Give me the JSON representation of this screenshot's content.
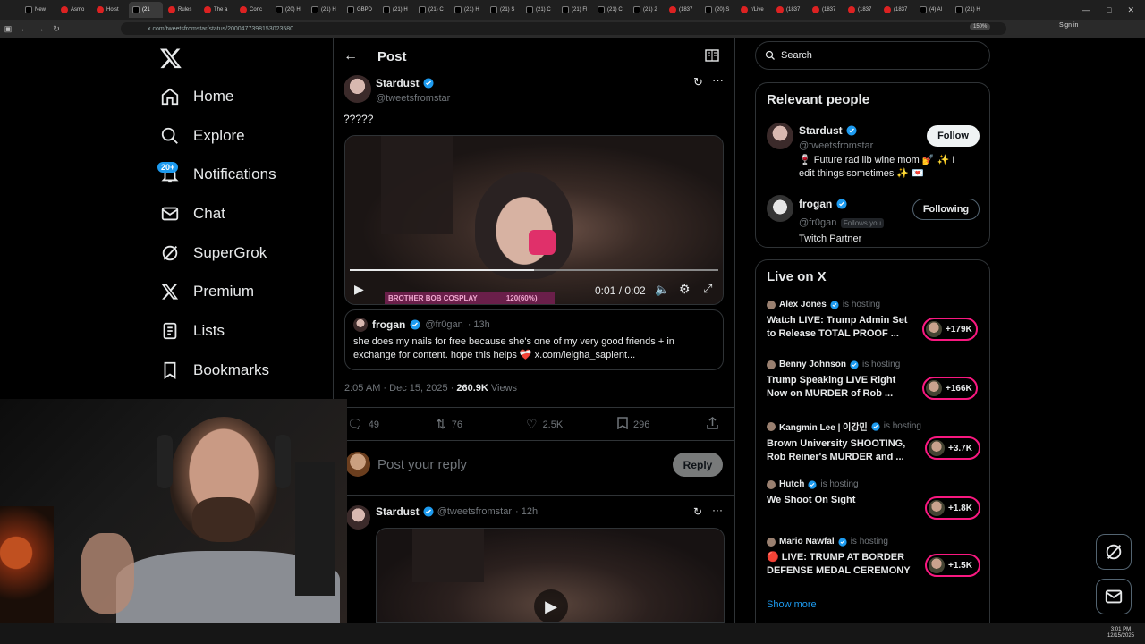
{
  "browser": {
    "tabs": [
      {
        "label": "New",
        "fav": "x"
      },
      {
        "label": "Asmo",
        "fav": "red"
      },
      {
        "label": "Hoist",
        "fav": "red"
      },
      {
        "label": "(21",
        "fav": "x",
        "active": true
      },
      {
        "label": "Rules",
        "fav": "red"
      },
      {
        "label": "The a",
        "fav": "red"
      },
      {
        "label": "Conc",
        "fav": "red"
      },
      {
        "label": "(20) H",
        "fav": "x"
      },
      {
        "label": "(21) H",
        "fav": "x"
      },
      {
        "label": "GBPD",
        "fav": "x"
      },
      {
        "label": "(21) H",
        "fav": "x"
      },
      {
        "label": "(21) C",
        "fav": "x"
      },
      {
        "label": "(21) H",
        "fav": "x"
      },
      {
        "label": "(21) S",
        "fav": "x"
      },
      {
        "label": "(21) C",
        "fav": "x"
      },
      {
        "label": "(21) Fl",
        "fav": "x"
      },
      {
        "label": "(21) C",
        "fav": "x"
      },
      {
        "label": "(21) 2",
        "fav": "x"
      },
      {
        "label": "(1837",
        "fav": "red"
      },
      {
        "label": "(20) S",
        "fav": "x"
      },
      {
        "label": "r/Live",
        "fav": "red"
      },
      {
        "label": "(1837",
        "fav": "red"
      },
      {
        "label": "(1837",
        "fav": "red"
      },
      {
        "label": "(1837",
        "fav": "red"
      },
      {
        "label": "(1837",
        "fav": "red"
      },
      {
        "label": "(4) Al",
        "fav": "x"
      },
      {
        "label": "(21) H",
        "fav": "x"
      }
    ],
    "url": "x.com/tweetsfromstar/status/2000477398153023580",
    "zoom": "150%",
    "signin": "Sign in"
  },
  "nav": {
    "items": [
      {
        "label": "Home",
        "icon": "home-icon"
      },
      {
        "label": "Explore",
        "icon": "search-icon"
      },
      {
        "label": "Notifications",
        "icon": "bell-icon"
      },
      {
        "label": "Chat",
        "icon": "mail-icon"
      },
      {
        "label": "SuperGrok",
        "icon": "grok-icon"
      },
      {
        "label": "Premium",
        "icon": "x-icon"
      },
      {
        "label": "Lists",
        "icon": "list-icon"
      },
      {
        "label": "Bookmarks",
        "icon": "bookmark-icon"
      }
    ],
    "notif_badge": "20+"
  },
  "post": {
    "header_title": "Post",
    "author_name": "Stardust",
    "author_handle": "@tweetsfromstar",
    "text": "?????",
    "video_time": "0:01 / 0:02",
    "video_overlay_text": "BROTHER BOB COSPLAY",
    "video_overlay_pct": "120(60%)",
    "quote": {
      "name": "frogan",
      "handle": "@fr0gan",
      "time": "· 13h",
      "text": "she does my nails for free because she's one of my very good friends + in exchange for content. hope this helps ❤️‍🩹 x.com/leigha_sapient..."
    },
    "timestamp": "2:05 AM · Dec 15, 2025 ·",
    "views_count": "260.9K",
    "views_label": "Views",
    "replies": "49",
    "reposts": "76",
    "likes": "2.5K",
    "bookmarks": "296",
    "reply_placeholder": "Post your reply",
    "reply_button": "Reply"
  },
  "reply_post": {
    "name": "Stardust",
    "handle": "@tweetsfromstar",
    "time": "· 12h"
  },
  "search": {
    "placeholder": "Search"
  },
  "relevant": {
    "title": "Relevant people",
    "people": [
      {
        "name": "Stardust",
        "handle": "@tweetsfromstar",
        "bio": "🍷 Future rad lib wine mom 💅 ✨ I edit things sometimes ✨ 💌",
        "button": "Follow"
      },
      {
        "name": "frogan",
        "handle": "@fr0gan",
        "follows_you": "Follows you",
        "bio": "Twitch Partner",
        "button": "Following"
      }
    ]
  },
  "live": {
    "title": "Live on X",
    "items": [
      {
        "host": "Alex Jones",
        "hosting": "is hosting",
        "title": "Watch LIVE: Trump Admin Set to Release TOTAL PROOF ...",
        "count": "+179K"
      },
      {
        "host": "Benny Johnson",
        "hosting": "is hosting",
        "title": "Trump Speaking LIVE Right Now on MURDER of Rob ...",
        "count": "+166K"
      },
      {
        "host": "Kangmin Lee | 이강민",
        "hosting": "is hosting",
        "title": "Brown University SHOOTING, Rob Reiner's MURDER and ...",
        "count": "+3.7K"
      },
      {
        "host": "Hutch",
        "hosting": "is hosting",
        "title": "We Shoot On Sight",
        "count": "+1.8K"
      },
      {
        "host": "Mario Nawfal",
        "hosting": "is hosting",
        "title": "🔴 LIVE: TRUMP AT BORDER DEFENSE MEDAL CEREMONY",
        "count": "+1.5K"
      }
    ],
    "show_more": "Show more"
  },
  "clock": {
    "time": "3:01 PM",
    "date": "12/15/2025"
  },
  "colors": {
    "accent": "#1d9bf0",
    "live": "#f91880",
    "border": "#2f3336"
  }
}
